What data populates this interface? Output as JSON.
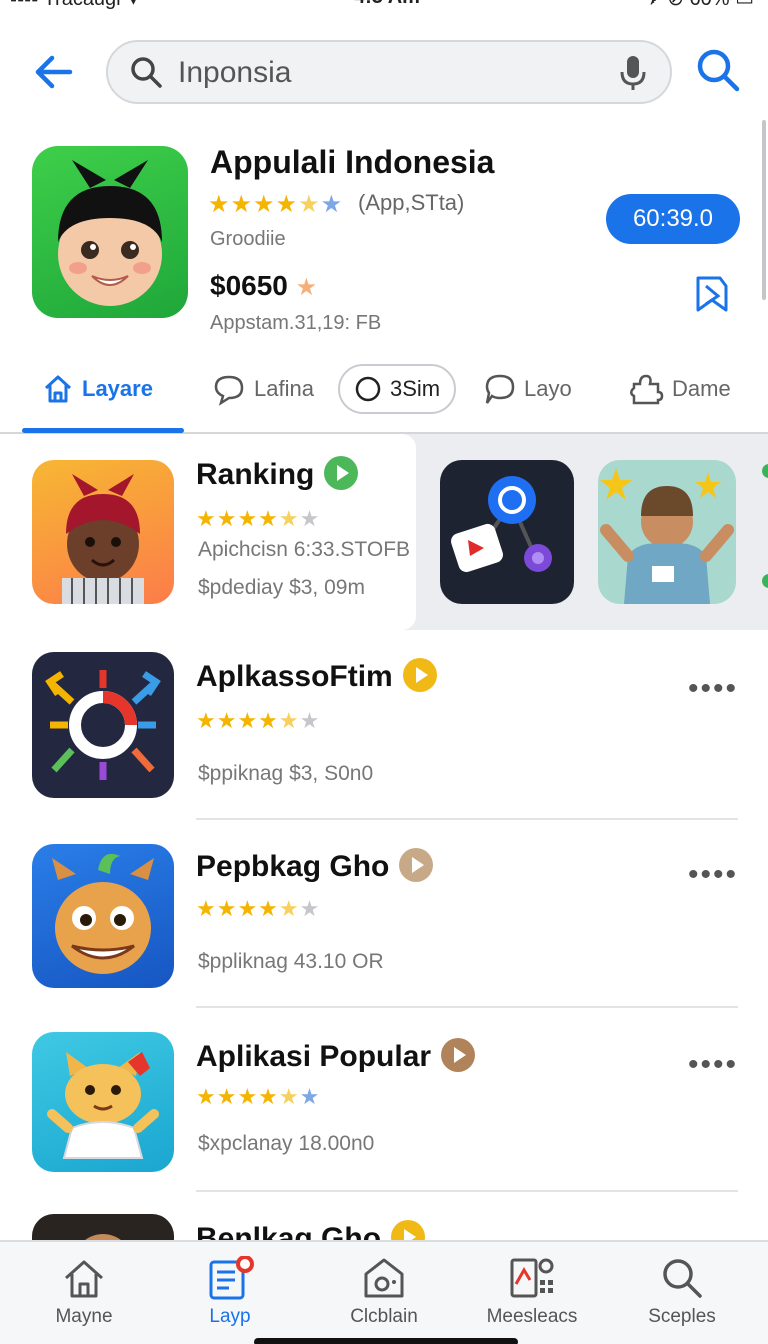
{
  "status": {
    "carrier": "▪▪▪▪ Tracaugr ▾",
    "time": "4:3 Am",
    "battery": "✈ ⊘ 60% ▭"
  },
  "search": {
    "query": "Inponsia"
  },
  "featured": {
    "title": "Appulali Indonesia",
    "stars": "★★★★☆",
    "rating_meta": "(App,STta)",
    "developer": "Groodiie",
    "price": "$0650",
    "size": "Appstam.31,19: FB",
    "action_label": "60:39.0",
    "rating_value": 4.5
  },
  "tabs": [
    {
      "label": "Layare",
      "icon": "home-icon",
      "active": true
    },
    {
      "label": "Lafina",
      "icon": "chat-bubble-icon"
    },
    {
      "label": "3Sim",
      "icon": "circle-icon"
    },
    {
      "label": "Layo",
      "icon": "speech-icon"
    },
    {
      "label": "Dame",
      "icon": "puzzle-icon"
    }
  ],
  "ranking": {
    "title": "Ranking",
    "stars": "★★★★★",
    "line1": "Apichcisn 6:33.STOFB",
    "line2": "$pdediay $3, 09m",
    "rating_value": 4.5
  },
  "apps": [
    {
      "title": "AplkassoFtim",
      "stars": "★★★★★",
      "sub": "$ppiknag $3, S0n0",
      "badge_color": "#f0b916",
      "rating_value": 4.5
    },
    {
      "title": "Pepbkag Gho",
      "stars": "★★★★★",
      "sub": "$ppliknag 43.10 OR",
      "badge_color": "#c8a987",
      "rating_value": 4.5
    },
    {
      "title": "Aplikasi Popular",
      "stars": "★★★★★",
      "sub": "$xpclanay 18.00n0",
      "badge_color": "#b0835a",
      "rating_value": 4.5
    },
    {
      "title": "Benlkag Gho",
      "stars": "",
      "sub": "",
      "badge_color": "#f0b916"
    }
  ],
  "more_label": "••••",
  "nav": [
    {
      "label": "Mayne",
      "icon": "home-icon"
    },
    {
      "label": "Layp",
      "icon": "list-icon",
      "active": true
    },
    {
      "label": "Clcblain",
      "icon": "camera-icon"
    },
    {
      "label": "Meesleacs",
      "icon": "apps-icon"
    },
    {
      "label": "Sceples",
      "icon": "search-icon"
    }
  ],
  "colors": {
    "accent": "#1a73e8",
    "star": "#f5b400",
    "star_blue": "#7ea7e6"
  }
}
